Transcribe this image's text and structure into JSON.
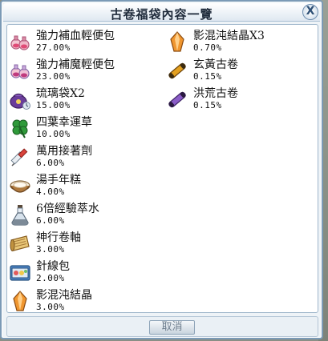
{
  "window": {
    "title": "古卷福袋內容一覽",
    "close_label": "X"
  },
  "items_left": [
    {
      "name": "強力補血輕便包",
      "rate": "27.00%",
      "icon": "red-potion-pack-icon"
    },
    {
      "name": "強力補魔輕便包",
      "rate": "23.00%",
      "icon": "blue-potion-pack-icon"
    },
    {
      "name": "琉璃袋X2",
      "rate": "15.00%",
      "icon": "glass-pouch-icon"
    },
    {
      "name": "四葉幸運草",
      "rate": "10.00%",
      "icon": "four-leaf-clover-icon"
    },
    {
      "name": "萬用接著劑",
      "rate": "6.00%",
      "icon": "glue-syringe-icon"
    },
    {
      "name": "湯手年糕",
      "rate": "4.00%",
      "icon": "rice-cake-bowl-icon"
    },
    {
      "name": "6倍經驗萃水",
      "rate": "6.00%",
      "icon": "exp-flask-icon"
    },
    {
      "name": "神行卷軸",
      "rate": "3.00%",
      "icon": "travel-scroll-icon"
    },
    {
      "name": "針線包",
      "rate": "2.00%",
      "icon": "sewing-kit-icon"
    },
    {
      "name": "影混沌結晶",
      "rate": "3.00%",
      "icon": "chaos-crystal-icon"
    }
  ],
  "items_right": [
    {
      "name": "影混沌結晶X3",
      "rate": "0.70%",
      "icon": "chaos-crystal-icon"
    },
    {
      "name": "玄黃古卷",
      "rate": "0.15%",
      "icon": "yellow-ancient-scroll-icon"
    },
    {
      "name": "洪荒古卷",
      "rate": "0.15%",
      "icon": "purple-ancient-scroll-icon"
    }
  ],
  "footer": {
    "cancel_label": "取消"
  }
}
